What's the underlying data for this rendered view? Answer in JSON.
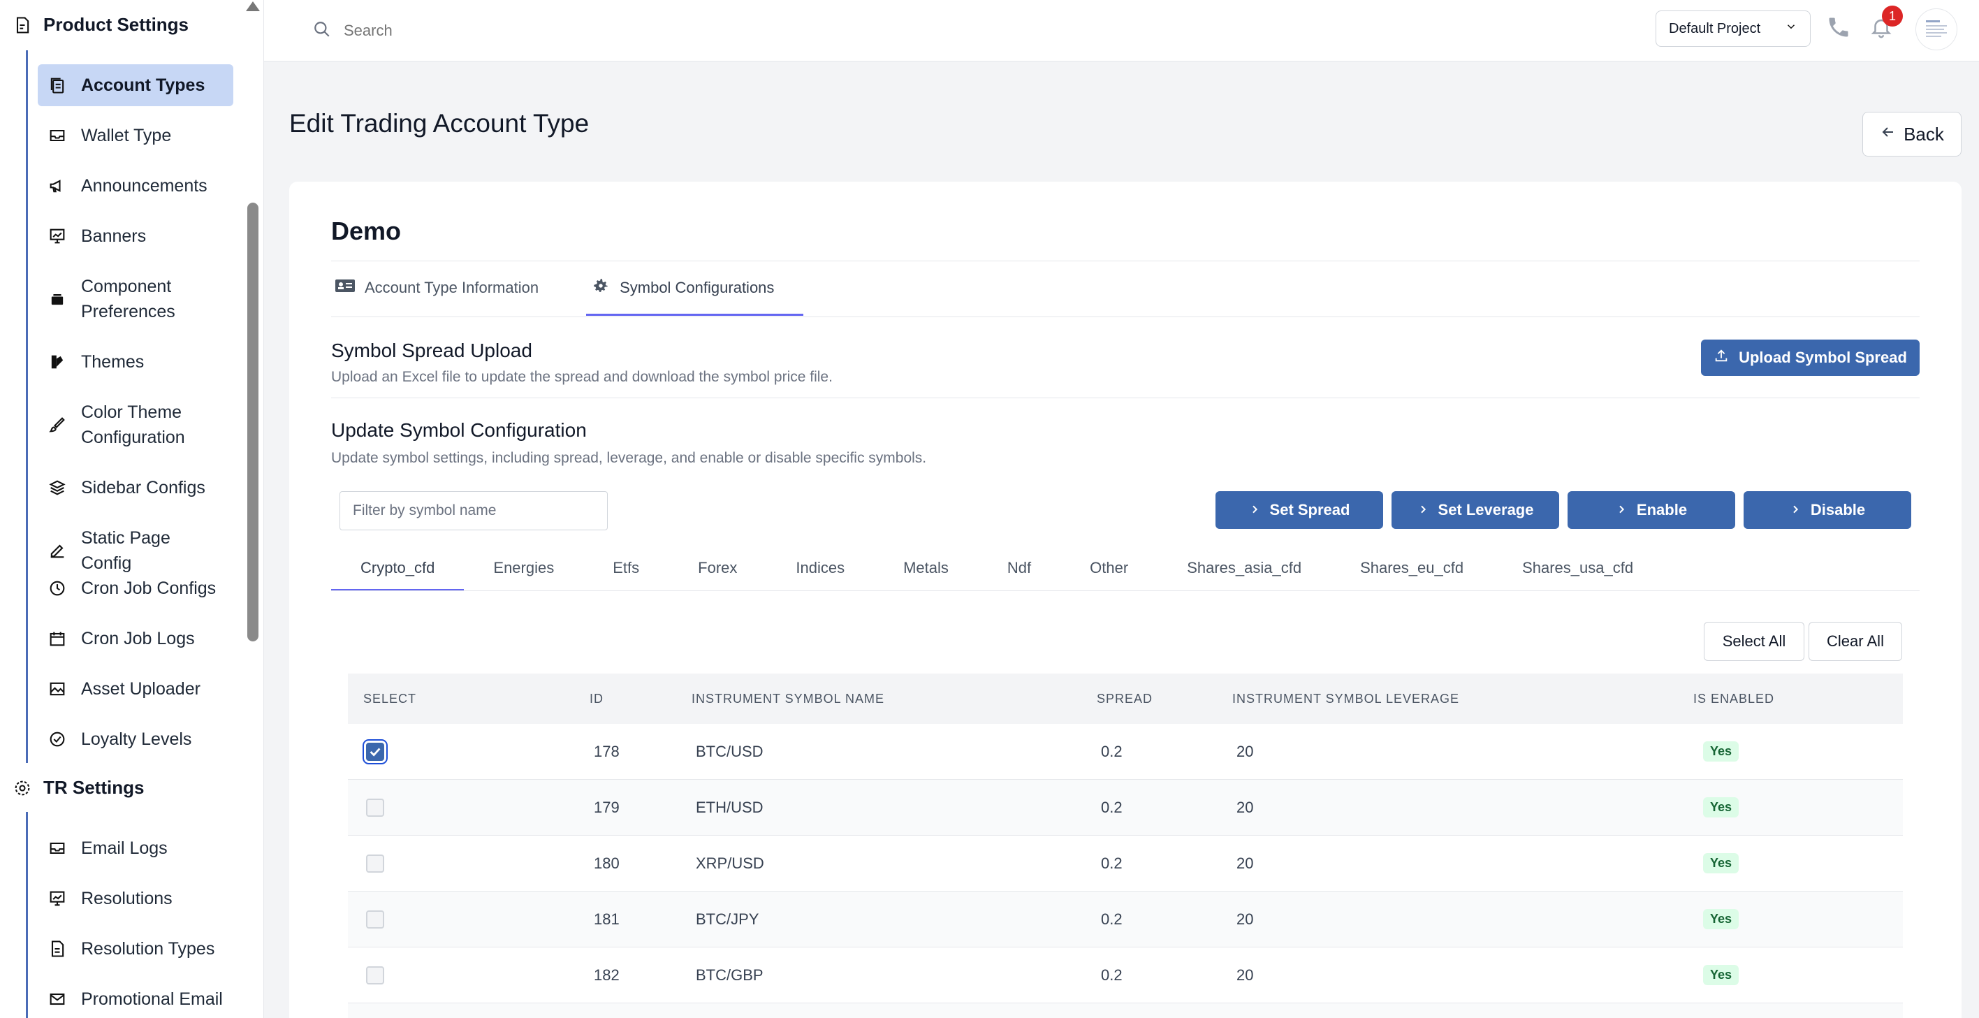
{
  "sidebar": {
    "product_settings_label": "Product Settings",
    "tr_settings_label": "TR Settings",
    "items": [
      {
        "label": "Account Types",
        "icon": "copy-icon"
      },
      {
        "label": "Wallet Type",
        "icon": "wallet-icon"
      },
      {
        "label": "Announcements",
        "icon": "megaphone-icon"
      },
      {
        "label": "Banners",
        "icon": "presentation-icon"
      },
      {
        "label": "Component Preferences",
        "icon": "box-icon"
      },
      {
        "label": "Themes",
        "icon": "palette-icon"
      },
      {
        "label": "Color Theme Configuration",
        "icon": "brush-icon"
      },
      {
        "label": "Sidebar Configs",
        "icon": "layers-icon"
      },
      {
        "label": "Static Page Config",
        "icon": "edit-icon"
      },
      {
        "label": "Cron Job Configs",
        "icon": "clock-icon"
      },
      {
        "label": "Cron Job Logs",
        "icon": "calendar-icon"
      },
      {
        "label": "Asset Uploader",
        "icon": "image-icon"
      },
      {
        "label": "Loyalty Levels",
        "icon": "check-circle-icon"
      }
    ],
    "tr_items": [
      {
        "label": "Email Logs",
        "icon": "inbox-icon"
      },
      {
        "label": "Resolutions",
        "icon": "presentation-icon"
      },
      {
        "label": "Resolution Types",
        "icon": "file-icon"
      },
      {
        "label": "Promotional Email",
        "icon": "mail-icon"
      }
    ]
  },
  "topbar": {
    "search_placeholder": "Search",
    "project": "Default Project",
    "notification_count": "1"
  },
  "page": {
    "title": "Edit Trading Account Type",
    "back_label": "Back"
  },
  "card": {
    "title": "Demo",
    "tabs": [
      "Account Type Information",
      "Symbol Configurations"
    ],
    "upload": {
      "title": "Symbol Spread Upload",
      "subtitle": "Upload an Excel file to update the spread and download the symbol price file.",
      "button": "Upload Symbol Spread"
    },
    "update": {
      "title": "Update Symbol Configuration",
      "subtitle": "Update symbol settings, including spread, leverage, and enable or disable specific symbols.",
      "filter_placeholder": "Filter by symbol name",
      "actions": [
        "Set Spread",
        "Set Leverage",
        "Enable",
        "Disable"
      ]
    },
    "categories": [
      "Crypto_cfd",
      "Energies",
      "Etfs",
      "Forex",
      "Indices",
      "Metals",
      "Ndf",
      "Other",
      "Shares_asia_cfd",
      "Shares_eu_cfd",
      "Shares_usa_cfd"
    ],
    "select_all": "Select All",
    "clear_all": "Clear All",
    "table": {
      "headers": [
        "SELECT",
        "ID",
        "INSTRUMENT SYMBOL NAME",
        "SPREAD",
        "INSTRUMENT SYMBOL LEVERAGE",
        "IS ENABLED"
      ],
      "rows": [
        {
          "checked": true,
          "id": "178",
          "name": "BTC/USD",
          "spread": "0.2",
          "leverage": "20",
          "enabled": "Yes"
        },
        {
          "checked": false,
          "id": "179",
          "name": "ETH/USD",
          "spread": "0.2",
          "leverage": "20",
          "enabled": "Yes"
        },
        {
          "checked": false,
          "id": "180",
          "name": "XRP/USD",
          "spread": "0.2",
          "leverage": "20",
          "enabled": "Yes"
        },
        {
          "checked": false,
          "id": "181",
          "name": "BTC/JPY",
          "spread": "0.2",
          "leverage": "20",
          "enabled": "Yes"
        },
        {
          "checked": false,
          "id": "182",
          "name": "BTC/GBP",
          "spread": "0.2",
          "leverage": "20",
          "enabled": "Yes"
        }
      ]
    }
  },
  "colors": {
    "primary": "#3b67ad",
    "active_sidebar": "#c7d7f5",
    "tab_underline": "#6366f1",
    "badge": "#dc2626",
    "enabled_pill": "#dcfce7"
  }
}
